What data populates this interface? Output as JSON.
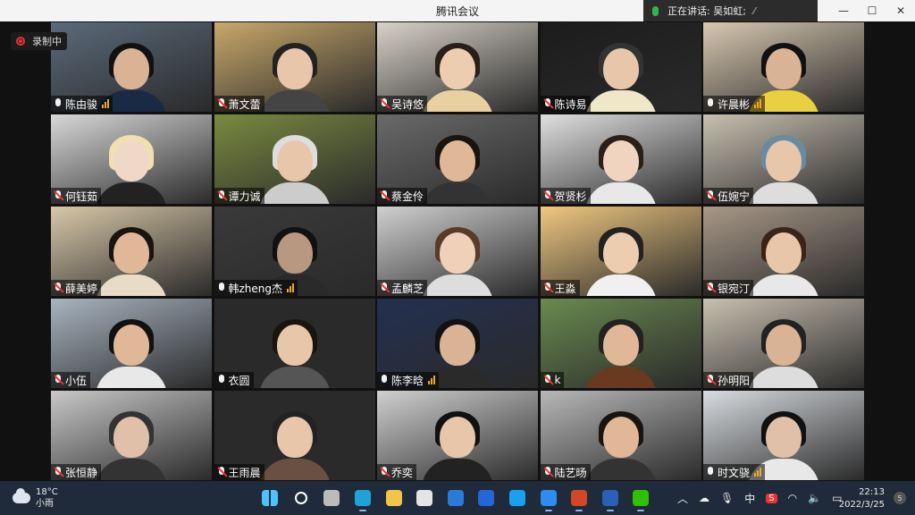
{
  "window": {
    "title": "腾讯会议",
    "speaking_label": "正在讲话: 吴如虹;",
    "controls": {
      "minimize": "—",
      "maximize": "☐",
      "close": "✕"
    }
  },
  "recording": {
    "label": "录制中"
  },
  "participants": [
    {
      "name": "陈由骏",
      "muted": false,
      "speaking": true,
      "bg": "#5a6a7a",
      "skin": "#d9b394",
      "hair": "#111",
      "shirt": "#1a2a44"
    },
    {
      "name": "萧文蕾",
      "muted": true,
      "speaking": false,
      "bg": "#c9a86a",
      "skin": "#e8c6aa",
      "hair": "#222",
      "shirt": "#444"
    },
    {
      "name": "吴诗悠",
      "muted": true,
      "speaking": false,
      "bg": "#d8d2c8",
      "skin": "#eccdb0",
      "hair": "#2a1e18",
      "shirt": "#e8d0a0"
    },
    {
      "name": "陈诗易",
      "muted": true,
      "speaking": false,
      "bg": "#1c1c1c",
      "skin": "#e8c6aa",
      "hair": "#333",
      "shirt": "#f0e6c8"
    },
    {
      "name": "许晨彬",
      "muted": false,
      "speaking": true,
      "bg": "#d8c8b0",
      "skin": "#d9b394",
      "hair": "#111",
      "shirt": "#e8d040"
    },
    {
      "name": "何钰茹",
      "muted": true,
      "speaking": false,
      "bg": "#d8d8d8",
      "skin": "#f0d8c8",
      "hair": "#f0e0b0",
      "shirt": "#222"
    },
    {
      "name": "谭力诚",
      "muted": true,
      "speaking": false,
      "bg": "#7a8a40",
      "skin": "#e8c6aa",
      "hair": "#ddd",
      "shirt": "#ccc"
    },
    {
      "name": "蔡金伶",
      "muted": true,
      "speaking": false,
      "bg": "#6a6a6a",
      "skin": "#e0b898",
      "hair": "#1a1410",
      "shirt": "#333"
    },
    {
      "name": "贺贤杉",
      "muted": true,
      "speaking": false,
      "bg": "#e0e0e0",
      "skin": "#f0d4c0",
      "hair": "#2a2018",
      "shirt": "#e8e8e8"
    },
    {
      "name": "伍婉宁",
      "muted": true,
      "speaking": false,
      "bg": "#c8c0b0",
      "skin": "#e8c6aa",
      "hair": "#6a8aa0",
      "shirt": "#ddd"
    },
    {
      "name": "薛美婷",
      "muted": true,
      "speaking": false,
      "bg": "#d8c8a8",
      "skin": "#e0b898",
      "hair": "#1a1410",
      "shirt": "#e8dcc8"
    },
    {
      "name": "韩zheng杰",
      "muted": false,
      "speaking": true,
      "bg": "#3a3a3a",
      "skin": "#b89880",
      "hair": "#111",
      "shirt": "#2a2a2a"
    },
    {
      "name": "孟麟芝",
      "muted": true,
      "speaking": false,
      "bg": "#d0d0d0",
      "skin": "#f0d0b8",
      "hair": "#5a3a28",
      "shirt": "#ddd"
    },
    {
      "name": "王淼",
      "muted": true,
      "speaking": false,
      "bg": "#f0c880",
      "skin": "#eccdb0",
      "hair": "#222",
      "shirt": "#f0f0f0"
    },
    {
      "name": "银宛汀",
      "muted": true,
      "speaking": false,
      "bg": "#a89888",
      "skin": "#e8c6aa",
      "hair": "#3a2418",
      "shirt": "#e8e8e8"
    },
    {
      "name": "小伍",
      "muted": true,
      "speaking": false,
      "bg": "#a8b4c0",
      "skin": "#e0b898",
      "hair": "#111",
      "shirt": "#e8e8e8"
    },
    {
      "name": "衣圆",
      "muted": false,
      "speaking": false,
      "bg": "#2a2a2a",
      "skin": "#e8c6aa",
      "hair": "#1a1410",
      "shirt": "#555"
    },
    {
      "name": "陈李晗",
      "muted": false,
      "speaking": true,
      "bg": "#223050",
      "skin": "#d9b394",
      "hair": "#111",
      "shirt": "#2a2a2a"
    },
    {
      "name": "k",
      "muted": true,
      "speaking": false,
      "bg": "#6a8a50",
      "skin": "#e0b898",
      "hair": "#222",
      "shirt": "#6a3a20"
    },
    {
      "name": "孙明阳",
      "muted": true,
      "speaking": false,
      "bg": "#c8c0b0",
      "skin": "#d9b394",
      "hair": "#222",
      "shirt": "#ddd"
    },
    {
      "name": "张恒静",
      "muted": true,
      "speaking": false,
      "bg": "#c8c8c8",
      "skin": "#e0c0a8",
      "hair": "#333",
      "shirt": "#333"
    },
    {
      "name": "王雨晨",
      "muted": true,
      "speaking": false,
      "bg": "#2a2a2a",
      "skin": "#e8c6aa",
      "hair": "#222",
      "shirt": "#6a5040"
    },
    {
      "name": "乔奕",
      "muted": true,
      "speaking": false,
      "bg": "#d0d0d0",
      "skin": "#e8c6aa",
      "hair": "#111",
      "shirt": "#222"
    },
    {
      "name": "陆艺旸",
      "muted": true,
      "speaking": false,
      "bg": "#b8b8b8",
      "skin": "#e0b898",
      "hair": "#1a1410",
      "shirt": "#333"
    },
    {
      "name": "时文骁",
      "muted": false,
      "speaking": true,
      "bg": "#d8dce0",
      "skin": "#e0c0a8",
      "hair": "#111",
      "shirt": "#e8e8e8"
    }
  ],
  "taskbar": {
    "weather": {
      "temp": "18°C",
      "desc": "小雨"
    },
    "apps": [
      {
        "id": "start",
        "icon": "windows-start-icon",
        "color": "#4cc2ff",
        "active": false
      },
      {
        "id": "search",
        "icon": "search-icon",
        "color": "#ffffff",
        "active": false
      },
      {
        "id": "taskview",
        "icon": "task-view-icon",
        "color": "#bbbbbb",
        "active": false
      },
      {
        "id": "edge",
        "icon": "edge-icon",
        "color": "#1fa2d8",
        "active": true
      },
      {
        "id": "explorer",
        "icon": "folder-icon",
        "color": "#f2c44a",
        "active": false
      },
      {
        "id": "store",
        "icon": "store-icon",
        "color": "#e4e4e4",
        "active": false
      },
      {
        "id": "mail",
        "icon": "mail-icon",
        "color": "#2a7bd8",
        "active": false
      },
      {
        "id": "l-app",
        "icon": "l-app-icon",
        "color": "#2466d8",
        "active": false
      },
      {
        "id": "edge2",
        "icon": "edge-icon",
        "color": "#1ba0f0",
        "active": false
      },
      {
        "id": "meeting",
        "icon": "tencent-meeting-icon",
        "color": "#2e8cf0",
        "active": true
      },
      {
        "id": "powerpoint",
        "icon": "powerpoint-icon",
        "color": "#d24726",
        "active": true
      },
      {
        "id": "word",
        "icon": "word-icon",
        "color": "#2b5fb8",
        "active": true
      },
      {
        "id": "wechat",
        "icon": "wechat-icon",
        "color": "#2dc100",
        "active": true
      }
    ],
    "tray": {
      "ime": "中",
      "s_logo": "S"
    },
    "clock": {
      "time": "22:13",
      "date": "2022/3/25"
    },
    "notification_count": "5"
  }
}
